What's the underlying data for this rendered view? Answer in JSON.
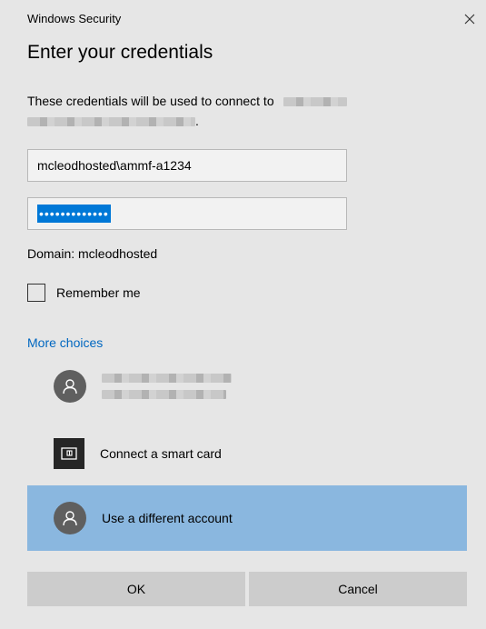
{
  "window": {
    "title": "Windows Security",
    "close_icon": "close-icon"
  },
  "heading": "Enter your credentials",
  "description": {
    "text": "These credentials will be used to connect to",
    "period": "."
  },
  "username": {
    "value": "mcleodhosted\\ammf-a1234"
  },
  "password": {
    "masked_value": "•••••••••••••"
  },
  "domain": {
    "text": "Domain: mcleodhosted"
  },
  "remember": {
    "label": "Remember me",
    "checked": false
  },
  "more_choices": {
    "label": "More choices"
  },
  "choices": [
    {
      "icon": "user-avatar-icon",
      "label": ""
    },
    {
      "icon": "smart-card-icon",
      "label": "Connect a smart card"
    },
    {
      "icon": "user-avatar-icon",
      "label": "Use a different account",
      "selected": true
    }
  ],
  "buttons": {
    "ok": "OK",
    "cancel": "Cancel"
  },
  "colors": {
    "accent": "#0078d7",
    "link": "#0067c0",
    "selected_row": "#8ab7df",
    "background": "#e6e6e6"
  }
}
